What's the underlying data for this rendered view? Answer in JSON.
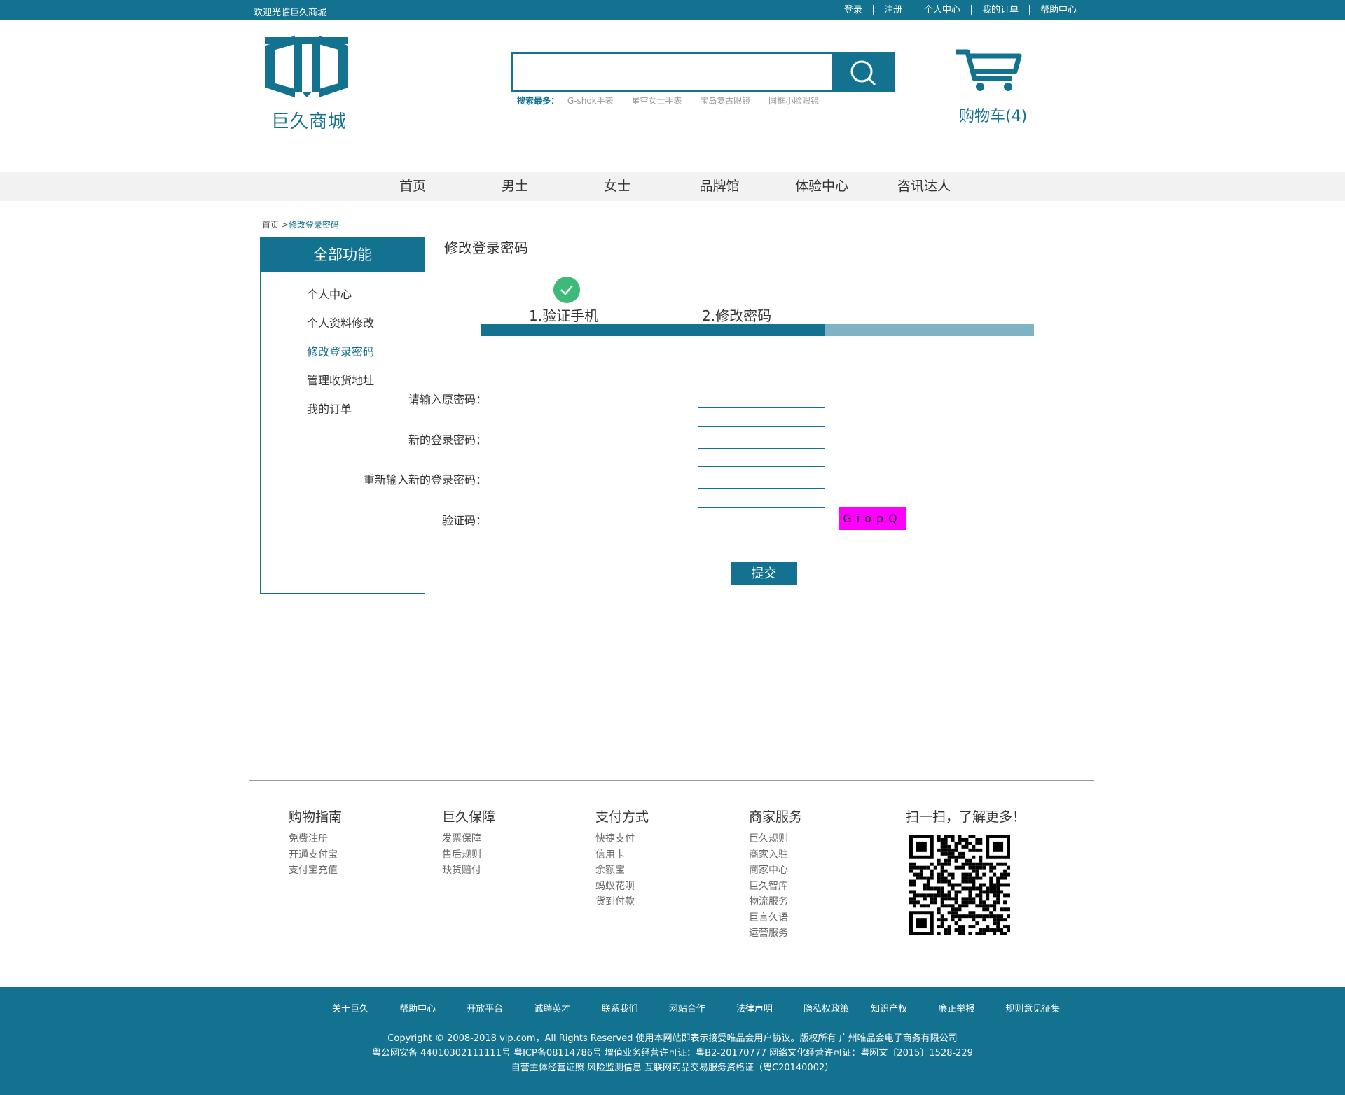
{
  "topbar": {
    "welcome": "欢迎光临巨久商城",
    "links": [
      "登录",
      "注册",
      "个人中心",
      "我的订单",
      "帮助中心"
    ]
  },
  "header": {
    "logo_text": "巨久商城",
    "search_placeholder": "",
    "hot_label": "搜索最多：",
    "hot_items": [
      "G-shok手表",
      "星空女士手表",
      "宝岛复古眼镜",
      "圆框小脸眼镜"
    ],
    "cart_text": "购物车(4)"
  },
  "nav": {
    "items": [
      "首页",
      "男士",
      "女士",
      "品牌馆",
      "体验中心",
      "咨讯达人"
    ]
  },
  "breadcrumb": {
    "home": "首页",
    "separator": " >",
    "current": "修改登录密码"
  },
  "sidebar": {
    "title": "全部功能",
    "items": [
      "个人中心",
      "个人资料修改",
      "修改登录密码",
      "管理收货地址",
      "我的订单"
    ],
    "active_index": 2
  },
  "main": {
    "title": "修改登录密码",
    "step1": "1.验证手机",
    "step2": "2.修改密码",
    "progress_fraction": 0.623,
    "fields": {
      "old_password_label": "请输入原密码：",
      "new_password_label": "新的登录密码：",
      "confirm_password_label": "重新输入新的登录密码：",
      "captcha_label": "验证码："
    },
    "captcha_text": "GiopQ",
    "submit_label": "提交"
  },
  "footer": {
    "columns": [
      {
        "title": "购物指南",
        "links": [
          "免费注册",
          "开通支付宝",
          "支付宝充值"
        ]
      },
      {
        "title": "巨久保障",
        "links": [
          "发票保障",
          "售后规则",
          "缺货赔付"
        ]
      },
      {
        "title": "支付方式",
        "links": [
          "快捷支付",
          "信用卡",
          "余额宝",
          "蚂蚁花呗",
          "货到付款"
        ]
      },
      {
        "title": "商家服务",
        "links": [
          "巨久规则",
          "商家入驻",
          "商家中心",
          "巨久智库",
          "物流服务",
          "巨言久语",
          "运营服务"
        ]
      }
    ],
    "qr_title": "扫一扫，了解更多！"
  },
  "bottom": {
    "links": [
      "关于巨久",
      "帮助中心",
      "开放平台",
      "诚聘英才",
      "联系我们",
      "网站合作",
      "法律声明",
      "隐私权政策",
      "知识产权",
      "廉正举报",
      "规则意见征集"
    ],
    "copyright": "Copyright © 2008-2018 vip.com，All Rights Reserved 使用本网站即表示接受唯品会用户协议。版权所有 广州唯品会电子商务有限公司",
    "license": "粤公网安备 44010302111111号 粤ICP备08114786号 增值业务经营许可证：粤B2-20170777 网络文化经营许可证：粤网文〔2015〕1528-229",
    "certs": "自营主体经营证照 风险监测信息 互联网药品交易服务资格证（粤C20140002）"
  },
  "colors": {
    "brand": "#12728f",
    "progress_track": "#7fb3c4",
    "check": "#3db979",
    "captcha_bg": "#ff00ff",
    "nav_bg": "#f2f2f2"
  }
}
